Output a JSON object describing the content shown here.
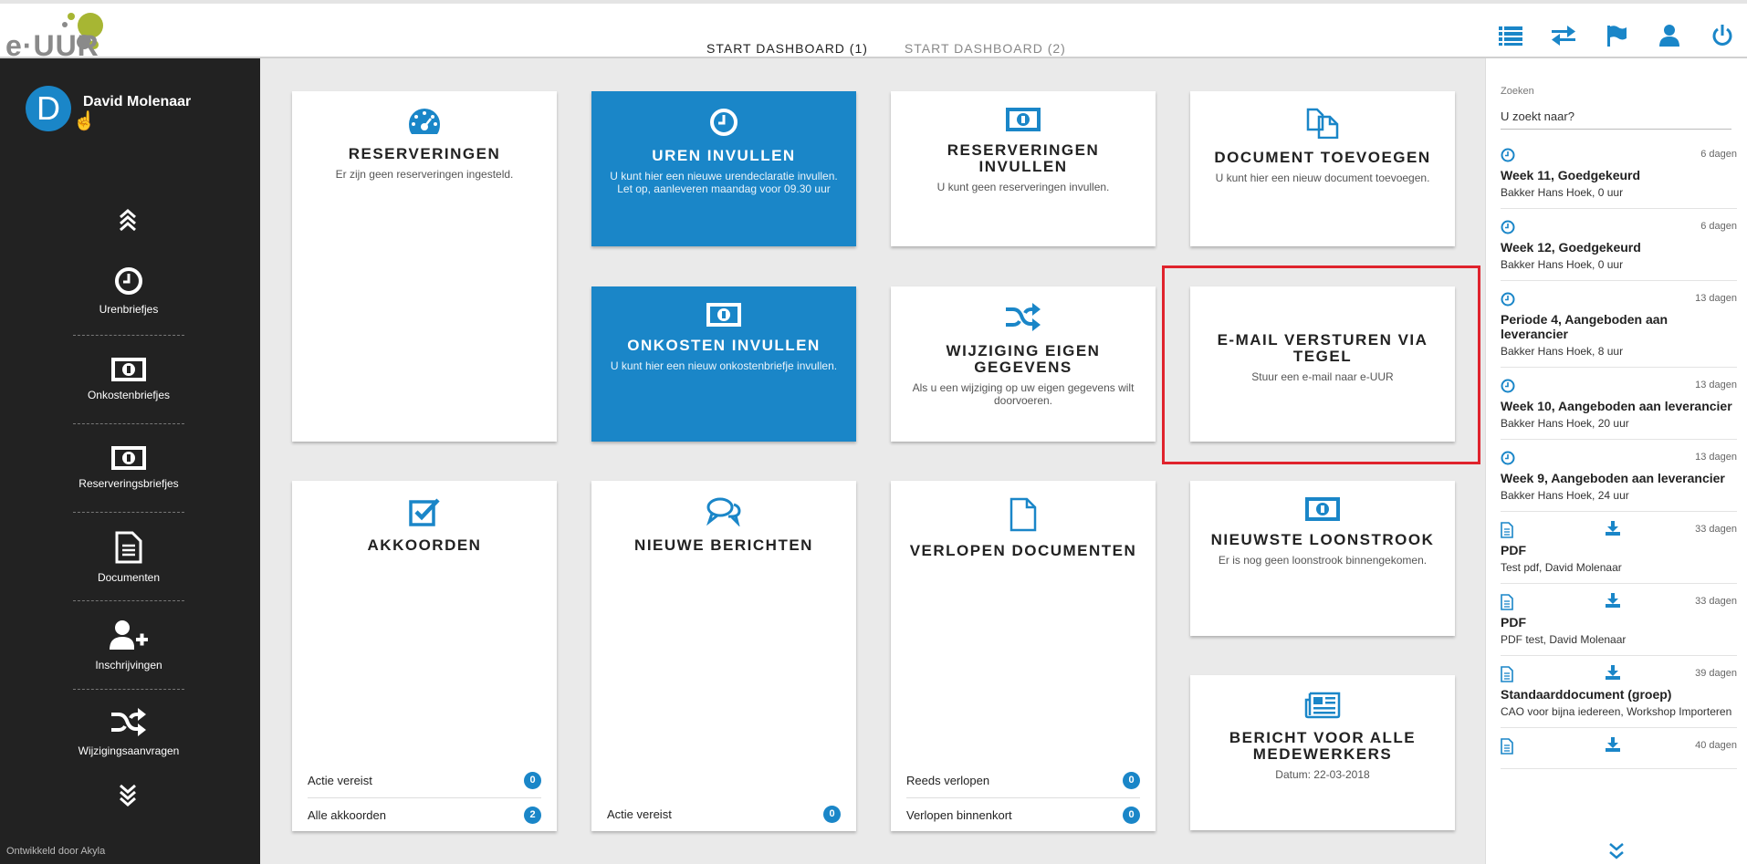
{
  "app": {
    "logo_text": "e·UUR"
  },
  "tabs": [
    {
      "label": "START DASHBOARD (1)"
    },
    {
      "label": "START DASHBOARD (2)"
    }
  ],
  "header_icons": [
    "list-icon",
    "swap-icon",
    "flag-icon",
    "user-icon",
    "power-icon"
  ],
  "user": {
    "initial": "D",
    "name": "David Molenaar"
  },
  "sidebar": {
    "items": [
      {
        "label": "Urenbriefjes",
        "icon": "clock-icon"
      },
      {
        "label": "Onkostenbriefjes",
        "icon": "banknote-icon"
      },
      {
        "label": "Reserveringsbriefjes",
        "icon": "banknote-icon"
      },
      {
        "label": "Documenten",
        "icon": "document-icon"
      },
      {
        "label": "Inschrijvingen",
        "icon": "add-user-icon"
      },
      {
        "label": "Wijzigingsaanvragen",
        "icon": "shuffle-icon"
      }
    ],
    "footer": "Ontwikkeld door Akyla"
  },
  "tiles": {
    "reserveringen": {
      "title": "RESERVERINGEN",
      "desc": "Er zijn geen reserveringen ingesteld."
    },
    "uren": {
      "title": "UREN INVULLEN",
      "desc": "U kunt hier een nieuwe urendeclaratie invullen. Let op, aanleveren maandag voor 09.30 uur"
    },
    "res_invullen": {
      "title": "RESERVERINGEN INVULLEN",
      "desc": "U kunt geen reserveringen invullen."
    },
    "document": {
      "title": "DOCUMENT TOEVOEGEN",
      "desc": "U kunt hier een nieuw document toevoegen."
    },
    "onkosten": {
      "title": "ONKOSTEN INVULLEN",
      "desc": "U kunt hier een nieuw onkostenbriefje invullen."
    },
    "wijziging": {
      "title": "WIJZIGING EIGEN GEGEVENS",
      "desc": "Als u een wijziging op uw eigen gegevens wilt doorvoeren."
    },
    "email": {
      "title": "E-MAIL VERSTUREN VIA TEGEL",
      "desc": "Stuur een e-mail naar e-UUR"
    },
    "akkoorden": {
      "title": "AKKOORDEN",
      "rows": [
        {
          "label": "Actie vereist",
          "count": "0"
        },
        {
          "label": "Alle akkoorden",
          "count": "2"
        }
      ]
    },
    "berichten": {
      "title": "NIEUWE BERICHTEN",
      "rows": [
        {
          "label": "Actie vereist",
          "count": "0"
        }
      ]
    },
    "verlopen": {
      "title": "VERLOPEN DOCUMENTEN",
      "rows": [
        {
          "label": "Reeds verlopen",
          "count": "0"
        },
        {
          "label": "Verlopen binnenkort",
          "count": "0"
        }
      ]
    },
    "loonstrook": {
      "title": "NIEUWSTE LOONSTROOK",
      "desc": "Er is nog geen loonstrook binnengekomen."
    },
    "bericht": {
      "title": "BERICHT VOOR ALLE MEDEWERKERS",
      "desc": "Datum: 22-03-2018"
    }
  },
  "search": {
    "label": "Zoeken",
    "placeholder": "U zoekt naar?"
  },
  "activity": [
    {
      "type": "clock",
      "days": "6 dagen",
      "title": "Week 11, Goedgekeurd",
      "sub": "Bakker Hans Hoek, 0 uur"
    },
    {
      "type": "clock",
      "days": "6 dagen",
      "title": "Week 12, Goedgekeurd",
      "sub": "Bakker Hans Hoek, 0 uur"
    },
    {
      "type": "clock",
      "days": "13 dagen",
      "title": "Periode 4, Aangeboden aan leverancier",
      "sub": "Bakker Hans Hoek, 8 uur"
    },
    {
      "type": "clock",
      "days": "13 dagen",
      "title": "Week 10, Aangeboden aan leverancier",
      "sub": "Bakker Hans Hoek, 20 uur"
    },
    {
      "type": "clock",
      "days": "13 dagen",
      "title": "Week 9, Aangeboden aan leverancier",
      "sub": "Bakker Hans Hoek, 24 uur"
    },
    {
      "type": "doc",
      "days": "33 dagen",
      "title": "PDF",
      "sub": "Test pdf, David Molenaar"
    },
    {
      "type": "doc",
      "days": "33 dagen",
      "title": "PDF",
      "sub": "PDF test, David Molenaar"
    },
    {
      "type": "doc",
      "days": "39 dagen",
      "title": "Standaarddocument (groep)",
      "sub": "CAO voor bijna iedereen, Workshop Importeren"
    },
    {
      "type": "doc",
      "days": "40 dagen",
      "title": "",
      "sub": ""
    }
  ],
  "colors": {
    "accent": "#1a86c8",
    "sidebar": "#222222",
    "highlight": "#e0232d"
  }
}
